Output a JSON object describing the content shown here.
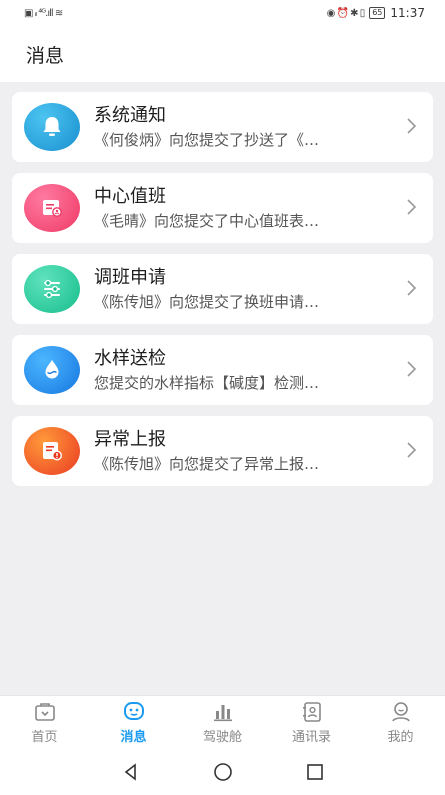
{
  "status_bar": {
    "left_glyphs": "▣ ᵢₗ ⁴ᴳ.ıll ≋",
    "right_glyphs": "◉ ⏰ ✱ ▯",
    "battery": "65",
    "time": "11:37"
  },
  "header": {
    "title": "消息"
  },
  "messages": [
    {
      "title": "系统通知",
      "preview": "《何俊炳》向您提交了抄送了《…",
      "icon": "bell-icon",
      "color": "#1aa0d8"
    },
    {
      "title": "中心值班",
      "preview": "《毛晴》向您提交了中心值班表…",
      "icon": "duty-roster-icon",
      "color": "#f0476f"
    },
    {
      "title": "调班申请",
      "preview": "《陈传旭》向您提交了换班申请…",
      "icon": "sliders-icon",
      "color": "#22c99a"
    },
    {
      "title": "水样送检",
      "preview": "您提交的水样指标【碱度】检测…",
      "icon": "water-drop-icon",
      "color": "#1c8ee8"
    },
    {
      "title": "异常上报",
      "preview": "《陈传旭》向您提交了异常上报…",
      "icon": "report-warning-icon",
      "color": "#f25a2a"
    }
  ],
  "tabs": [
    {
      "label": "首页",
      "icon": "home-icon",
      "active": false
    },
    {
      "label": "消息",
      "icon": "message-icon",
      "active": true
    },
    {
      "label": "驾驶舱",
      "icon": "bar-chart-icon",
      "active": false
    },
    {
      "label": "通讯录",
      "icon": "contacts-icon",
      "active": false
    },
    {
      "label": "我的",
      "icon": "profile-icon",
      "active": false
    }
  ],
  "colors": {
    "accent": "#1a9bf0",
    "inactive": "#888888"
  }
}
